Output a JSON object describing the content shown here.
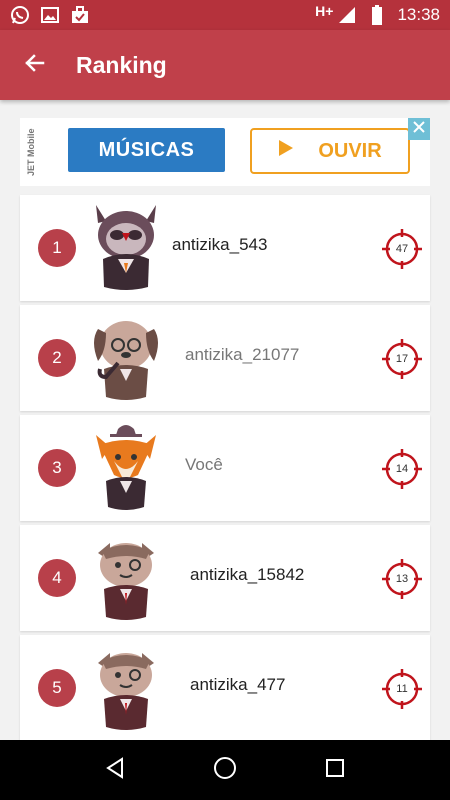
{
  "status_bar": {
    "time": "13:38",
    "network": "H+",
    "icons": [
      "whatsapp-icon",
      "image-icon",
      "briefcase-check-icon",
      "signal-icon",
      "battery-icon"
    ]
  },
  "app_bar": {
    "title": "Ranking",
    "back_icon": "arrow-left-icon"
  },
  "ad": {
    "brand": "JET Mobile",
    "button1_label": "MÚSICAS",
    "button2_label": "OUVIR",
    "close_icon": "close-icon",
    "colors": {
      "blue": "#2b7bc3",
      "orange": "#f0a020"
    }
  },
  "ranking": [
    {
      "rank": "1",
      "name": "antizika_543",
      "score": "47",
      "avatar": "owl-avatar",
      "highlight": false
    },
    {
      "rank": "2",
      "name": "antizika_21077",
      "score": "17",
      "avatar": "dog-avatar",
      "highlight": false
    },
    {
      "rank": "3",
      "name": "Você",
      "score": "14",
      "avatar": "fox-avatar",
      "highlight": false
    },
    {
      "rank": "4",
      "name": "antizika_15842",
      "score": "13",
      "avatar": "cat-avatar",
      "highlight": false
    },
    {
      "rank": "5",
      "name": "antizika_477",
      "score": "11",
      "avatar": "cat-avatar",
      "highlight": false
    }
  ],
  "nav_bar": {
    "icons": [
      "back-triangle-icon",
      "home-circle-icon",
      "recents-square-icon"
    ]
  },
  "colors": {
    "primary": "#c0404a",
    "status": "#b5323c",
    "rank_badge": "#b8404a",
    "target": "#c0141c"
  }
}
